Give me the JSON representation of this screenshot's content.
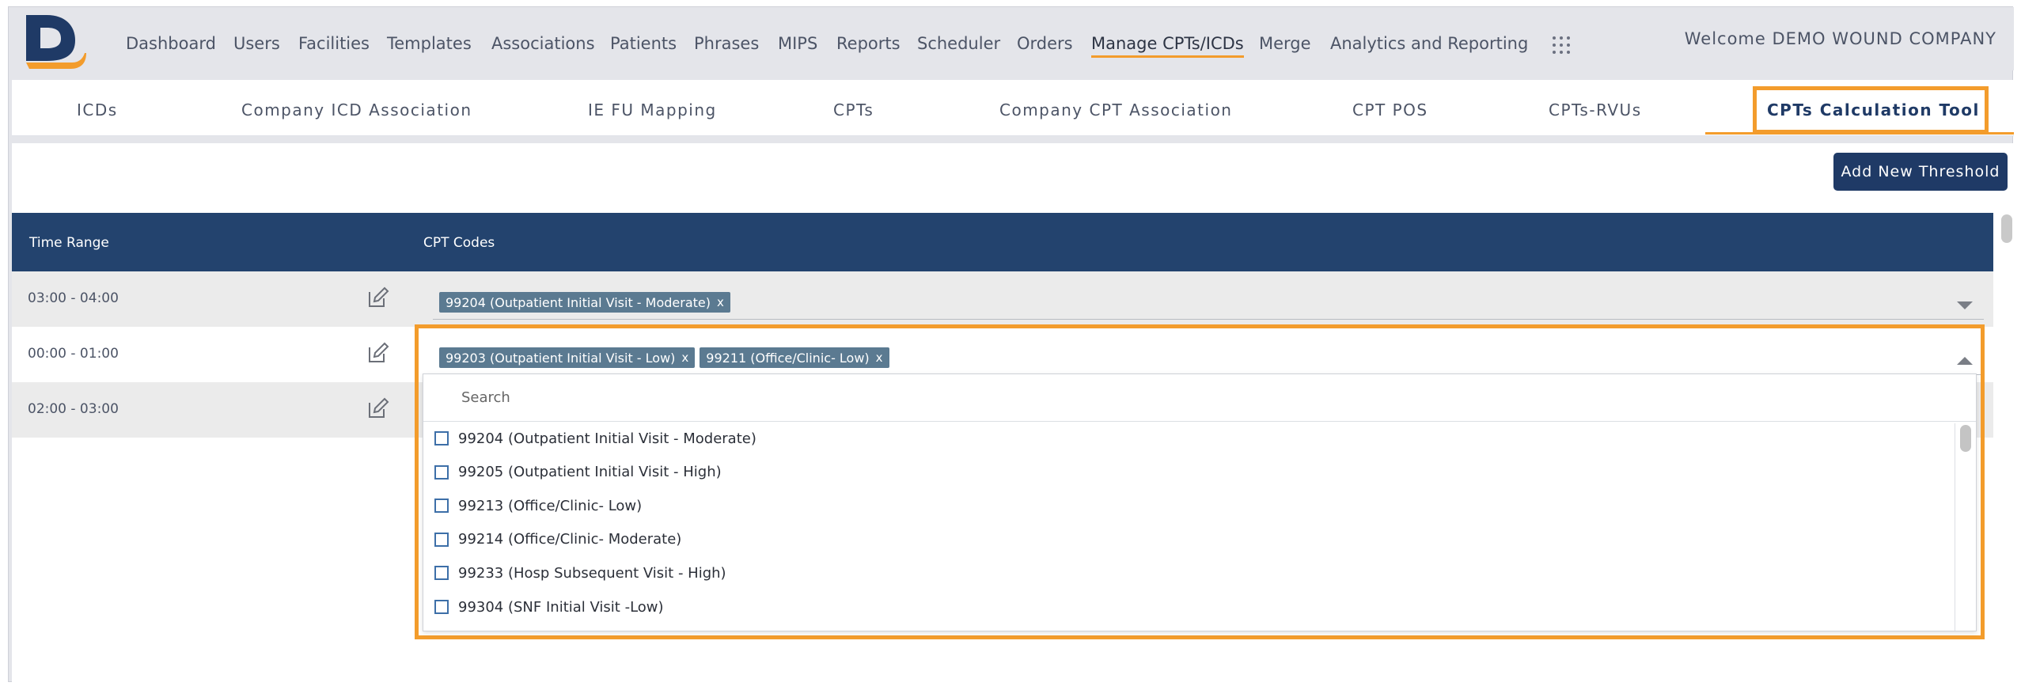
{
  "nav": {
    "items": [
      "Dashboard",
      "Users",
      "Facilities",
      "Templates",
      "Associations",
      "Patients",
      "Phrases",
      "MIPS",
      "Reports",
      "Scheduler",
      "Orders",
      "Manage CPTs/ICDs",
      "Merge",
      "Analytics and Reporting"
    ],
    "active_index": 11,
    "welcome": "Welcome DEMO WOUND COMPANY"
  },
  "subtabs": {
    "items": [
      "ICDs",
      "Company ICD Association",
      "IE FU Mapping",
      "CPTs",
      "Company CPT Association",
      "CPT POS",
      "CPTs-RVUs",
      "CPTs Calculation Tool"
    ],
    "active_index": 7
  },
  "toolbar": {
    "add_label": "Add New Threshold"
  },
  "table": {
    "headers": [
      "Time Range",
      "CPT Codes"
    ],
    "rows": [
      {
        "time": "03:00 - 04:00",
        "chips": [
          "99204 (Outpatient Initial Visit - Moderate)"
        ]
      },
      {
        "time": "00:00 - 01:00",
        "chips": [
          "99203 (Outpatient Initial Visit - Low)",
          "99211 (Office/Clinic- Low)"
        ]
      },
      {
        "time": "02:00 - 03:00",
        "chips": []
      }
    ]
  },
  "dropdown": {
    "search_placeholder": "Search",
    "options": [
      "99204 (Outpatient Initial Visit - Moderate)",
      "99205 (Outpatient Initial Visit - High)",
      "99213 (Office/Clinic- Low)",
      "99214 (Office/Clinic- Moderate)",
      "99233 (Hosp Subsequent Visit - High)",
      "99304 (SNF Initial Visit -Low)"
    ]
  },
  "colors": {
    "brand": "#1f3a66",
    "accent": "#f39c2c",
    "chip": "#5b7a91"
  },
  "icons": {
    "edit": "edit-icon",
    "apps": "grid-icon",
    "remove": "x"
  }
}
